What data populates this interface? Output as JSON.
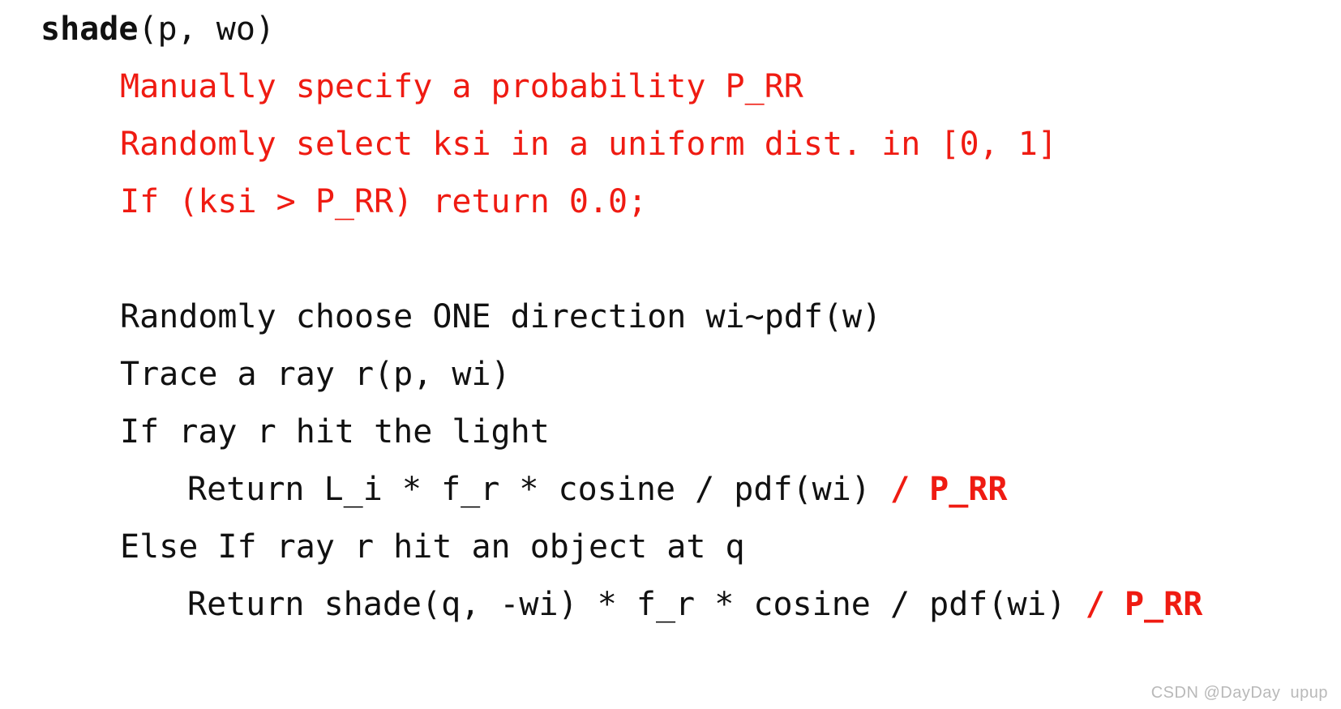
{
  "slide": {
    "background_color": "#ffffff",
    "text_color": "#111111",
    "accent_color": "#ef1b12",
    "watermark": "CSDN @DayDay  upup",
    "watermark_color": "#b9b9b9"
  },
  "code": {
    "signature": {
      "name": "shade",
      "params": "(p, wo)"
    },
    "russian_roulette": [
      "Manually specify a probability P_RR",
      "Randomly select ksi in a uniform dist. in [0, 1]",
      "If (ksi > P_RR) return 0.0;"
    ],
    "body": {
      "choose_direction": "Randomly choose ONE direction wi~pdf(w)",
      "trace_ray": "Trace a ray r(p, wi)",
      "if_hit_light": "If ray r hit the light",
      "return_light": "Return L_i * f_r * cosine / pdf(wi)",
      "return_light_rr": " / P_RR",
      "else_if_hit_object": "Else If ray r hit an object at q",
      "return_object": "Return shade(q, -wi) * f_r * cosine / pdf(wi)",
      "return_object_rr": " / P_RR"
    }
  }
}
